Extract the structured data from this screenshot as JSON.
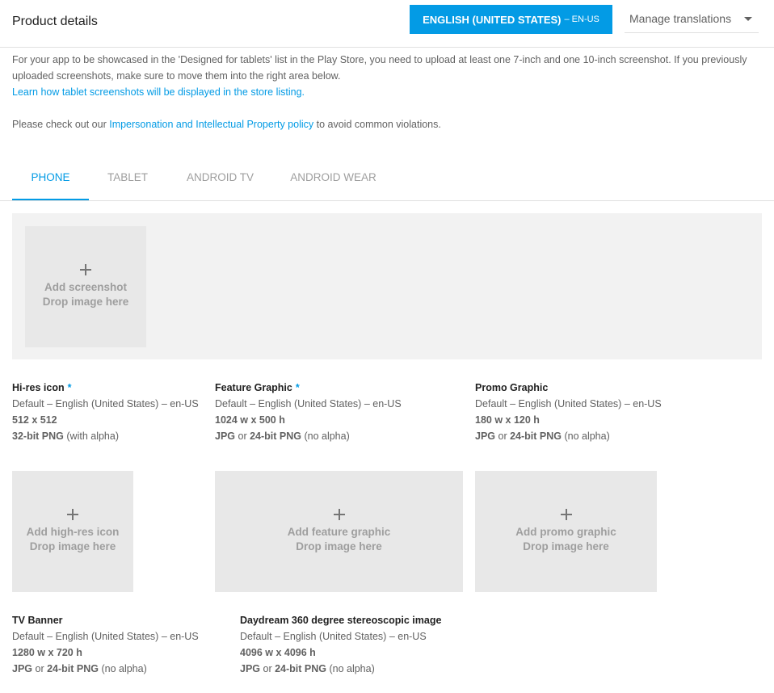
{
  "header": {
    "title": "Product details",
    "language_button": {
      "label": "ENGLISH (UNITED STATES)",
      "code": "– EN-US"
    },
    "manage_translations": "Manage translations"
  },
  "info": {
    "line1": "For your app to be showcased in the 'Designed for tablets' list in the Play Store, you need to upload at least one 7-inch and one 10-inch screenshot. If you previously uploaded screenshots, make sure to move them into the right area below.",
    "tablet_link": "Learn how tablet screenshots will be displayed in the store listing.",
    "policy_prefix": "Please check out our ",
    "policy_link": "Impersonation and Intellectual Property policy",
    "policy_suffix": " to avoid common violations."
  },
  "tabs": [
    {
      "label": "PHONE",
      "active": true
    },
    {
      "label": "TABLET",
      "active": false
    },
    {
      "label": "ANDROID TV",
      "active": false
    },
    {
      "label": "ANDROID WEAR",
      "active": false
    }
  ],
  "screenshot_drop": {
    "line1": "Add screenshot",
    "line2": "Drop image here"
  },
  "assets": {
    "hires_icon": {
      "name": "Hi-res icon",
      "required": "*",
      "locale": "Default – English (United States) – en-US",
      "size": "512 x 512",
      "format_bold": "32-bit PNG",
      "format_rest": " (with alpha)",
      "drop_line1": "Add high-res icon",
      "drop_line2": "Drop image here"
    },
    "feature_graphic": {
      "name": "Feature Graphic",
      "required": "*",
      "locale": "Default – English (United States) – en-US",
      "size": "1024 w x 500 h",
      "format_bold1": "JPG",
      "format_or": " or ",
      "format_bold2": "24-bit PNG",
      "format_rest": " (no alpha)",
      "drop_line1": "Add feature graphic",
      "drop_line2": "Drop image here"
    },
    "promo_graphic": {
      "name": "Promo Graphic",
      "locale": "Default – English (United States) – en-US",
      "size": "180 w x 120 h",
      "format_bold1": "JPG",
      "format_or": " or ",
      "format_bold2": "24-bit PNG",
      "format_rest": " (no alpha)",
      "drop_line1": "Add promo graphic",
      "drop_line2": "Drop image here"
    },
    "tv_banner": {
      "name": "TV Banner",
      "locale": "Default – English (United States) – en-US",
      "size": "1280 w x 720 h",
      "format_bold1": "JPG",
      "format_or": " or ",
      "format_bold2": "24-bit PNG",
      "format_rest": " (no alpha)"
    },
    "daydream": {
      "name": "Daydream 360 degree stereoscopic image",
      "locale": "Default – English (United States) – en-US",
      "size": "4096 w x 4096 h",
      "format_bold1": "JPG",
      "format_or": " or ",
      "format_bold2": "24-bit PNG",
      "format_rest": " (no alpha)"
    }
  },
  "colors": {
    "accent": "#039be5",
    "drop_bg": "#e8e8e8",
    "area_bg": "#f2f2f2"
  }
}
